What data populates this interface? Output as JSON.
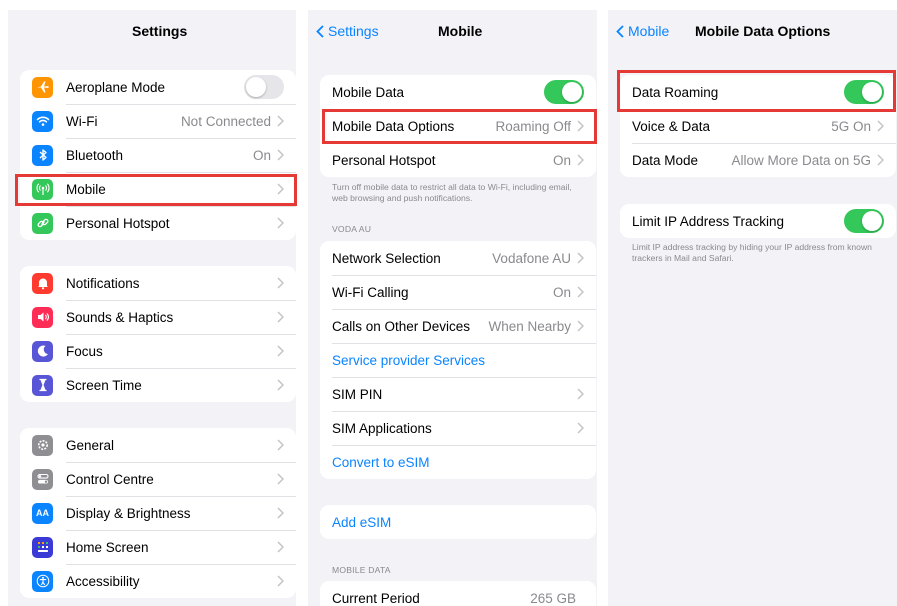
{
  "panel1": {
    "title": "Settings",
    "group1": [
      {
        "label": "Aeroplane Mode",
        "icon": "airplane-icon",
        "color": "#ff9500",
        "toggle": "off"
      },
      {
        "label": "Wi-Fi",
        "value": "Not Connected",
        "icon": "wifi-icon",
        "color": "#0a84ff"
      },
      {
        "label": "Bluetooth",
        "value": "On",
        "icon": "bluetooth-icon",
        "color": "#0a84ff"
      },
      {
        "label": "Mobile",
        "value": "",
        "icon": "antenna-icon",
        "color": "#34c759"
      },
      {
        "label": "Personal Hotspot",
        "value": "",
        "icon": "link-icon",
        "color": "#34c759"
      }
    ],
    "group2": [
      {
        "label": "Notifications",
        "icon": "bell-icon",
        "color": "#ff3b30"
      },
      {
        "label": "Sounds & Haptics",
        "icon": "speaker-icon",
        "color": "#ff2d55"
      },
      {
        "label": "Focus",
        "icon": "moon-icon",
        "color": "#5856d6"
      },
      {
        "label": "Screen Time",
        "icon": "hourglass-icon",
        "color": "#5856d6"
      }
    ],
    "group3": [
      {
        "label": "General",
        "icon": "gear-icon",
        "color": "#8e8e93"
      },
      {
        "label": "Control Centre",
        "icon": "switches-icon",
        "color": "#8e8e93"
      },
      {
        "label": "Display & Brightness",
        "icon": "display-icon",
        "color": "#0a84ff",
        "glyph": "AA"
      },
      {
        "label": "Home Screen",
        "icon": "grid-icon",
        "color": "#3a3ad6"
      },
      {
        "label": "Accessibility",
        "icon": "accessibility-icon",
        "color": "#0a84ff"
      }
    ]
  },
  "panel2": {
    "back": "Settings",
    "title": "Mobile",
    "group1": [
      {
        "label": "Mobile Data",
        "toggle": "on"
      },
      {
        "label": "Mobile Data Options",
        "value": "Roaming Off",
        "chevron": true
      },
      {
        "label": "Personal Hotspot",
        "value": "On",
        "chevron": true
      }
    ],
    "footnote1": "Turn off mobile data to restrict all data to Wi-Fi, including email, web browsing and push notifications.",
    "carrier_header": "VODA AU",
    "group2": [
      {
        "label": "Network Selection",
        "value": "Vodafone AU",
        "chevron": true
      },
      {
        "label": "Wi-Fi Calling",
        "value": "On",
        "chevron": true
      },
      {
        "label": "Calls on Other Devices",
        "value": "When Nearby",
        "chevron": true
      },
      {
        "label": "Service provider Services",
        "link": true
      },
      {
        "label": "SIM PIN",
        "value": "",
        "chevron": true
      },
      {
        "label": "SIM Applications",
        "value": "",
        "chevron": true
      },
      {
        "label": "Convert to eSIM",
        "link": true
      }
    ],
    "group3": [
      {
        "label": "Add eSIM",
        "link": true
      }
    ],
    "mobile_data_header": "MOBILE DATA",
    "group4": [
      {
        "label": "Current Period",
        "value": "265 GB"
      }
    ]
  },
  "panel3": {
    "back": "Mobile",
    "title": "Mobile Data Options",
    "group1": [
      {
        "label": "Data Roaming",
        "toggle": "on"
      },
      {
        "label": "Voice & Data",
        "value": "5G On",
        "chevron": true
      },
      {
        "label": "Data Mode",
        "value": "Allow More Data on 5G",
        "chevron": true
      }
    ],
    "group2": [
      {
        "label": "Limit IP Address Tracking",
        "toggle": "on"
      }
    ],
    "footnote": "Limit IP address tracking by hiding your IP address from known trackers in Mail and Safari."
  },
  "colors": {
    "accent": "#0a84ff",
    "toggle_on": "#34c759",
    "highlight": "#e53935",
    "background": "#f2f2f7"
  }
}
